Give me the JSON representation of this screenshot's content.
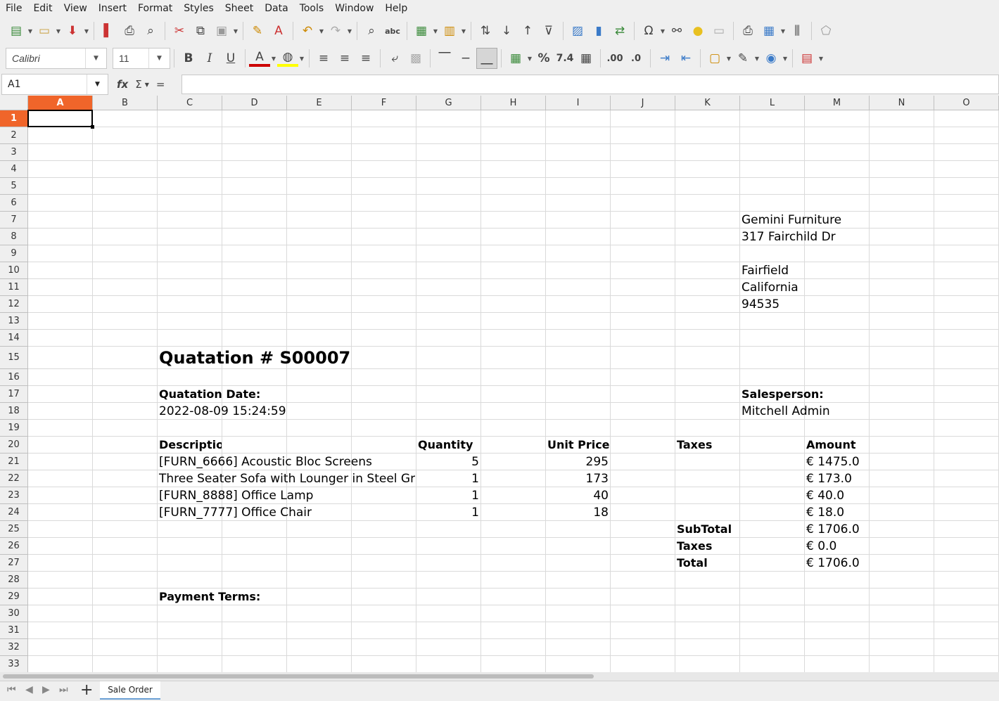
{
  "menu": [
    "File",
    "Edit",
    "View",
    "Insert",
    "Format",
    "Styles",
    "Sheet",
    "Data",
    "Tools",
    "Window",
    "Help"
  ],
  "font": {
    "name": "Calibri",
    "size": "11"
  },
  "formula_bar": {
    "cell_ref": "A1",
    "fx": "fx",
    "sum": "Σ",
    "eq": "=",
    "content": ""
  },
  "columns": [
    "A",
    "B",
    "C",
    "D",
    "E",
    "F",
    "G",
    "H",
    "I",
    "J",
    "K",
    "L",
    "M",
    "N",
    "O"
  ],
  "rows": [
    "1",
    "2",
    "3",
    "4",
    "5",
    "6",
    "7",
    "8",
    "9",
    "10",
    "11",
    "12",
    "13",
    "14",
    "15",
    "16",
    "17",
    "18",
    "19",
    "20",
    "21",
    "22",
    "23",
    "24",
    "25",
    "26",
    "27",
    "28",
    "29",
    "30",
    "31",
    "32",
    "33"
  ],
  "cells": {
    "L7": "Gemini Furniture",
    "L8": "317 Fairchild Dr",
    "L10": "Fairfield",
    "L11": "California",
    "L12": "94535",
    "C15": "Quatation # S00007",
    "C17": "Quatation Date:",
    "L17": "Salesperson:",
    "C18": "2022-08-09 15:24:59",
    "L18": "Mitchell Admin",
    "C20": "Description",
    "G20": "Quantity",
    "I20": "Unit Price",
    "K20": "Taxes",
    "M20": "Amount",
    "C21": "[FURN_6666] Acoustic Bloc Screens",
    "G21": "5",
    "I21": "295",
    "M21": "€ 1475.0",
    "C22": "Three Seater Sofa with Lounger in Steel Grey",
    "G22": "1",
    "I22": "173",
    "M22": "€ 173.0",
    "C23": "[FURN_8888] Office Lamp",
    "G23": "1",
    "I23": "40",
    "M23": "€ 40.0",
    "C24": "[FURN_7777] Office Chair",
    "G24": "1",
    "I24": "18",
    "M24": "€ 18.0",
    "K25": "SubTotal",
    "M25": "€ 1706.0",
    "K26": "Taxes",
    "M26": "€ 0.0",
    "K27": "Total",
    "M27": "€ 1706.0",
    "C29": "Payment Terms:"
  },
  "sheet_tabs": [
    "Sale Order"
  ],
  "colors": {
    "selected_header": "#f0652a",
    "chrome": "#efefef"
  }
}
